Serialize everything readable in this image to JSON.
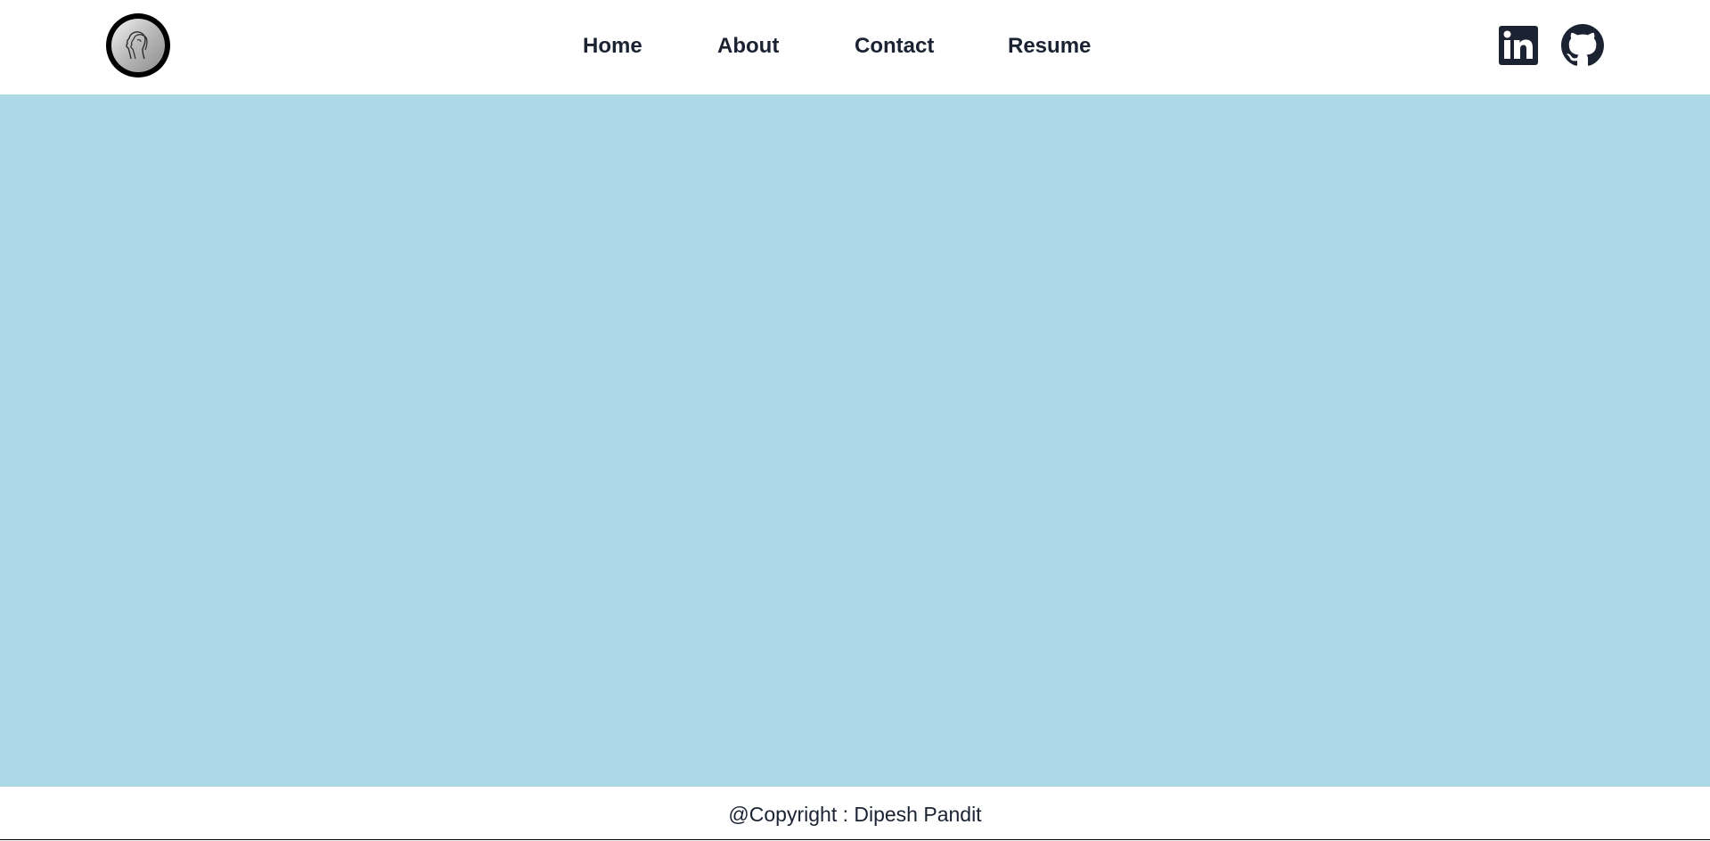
{
  "header": {
    "logo_icon": "profile-silhouette-icon",
    "nav": {
      "home": "Home",
      "about": "About",
      "contact": "Contact",
      "resume": "Resume"
    },
    "social": {
      "linkedin_icon": "linkedin-icon",
      "github_icon": "github-icon"
    }
  },
  "footer": {
    "copyright": "@Copyright : Dipesh Pandit"
  },
  "colors": {
    "nav_text": "#1b2232",
    "main_background": "#add8e6",
    "header_background": "#ffffff"
  }
}
